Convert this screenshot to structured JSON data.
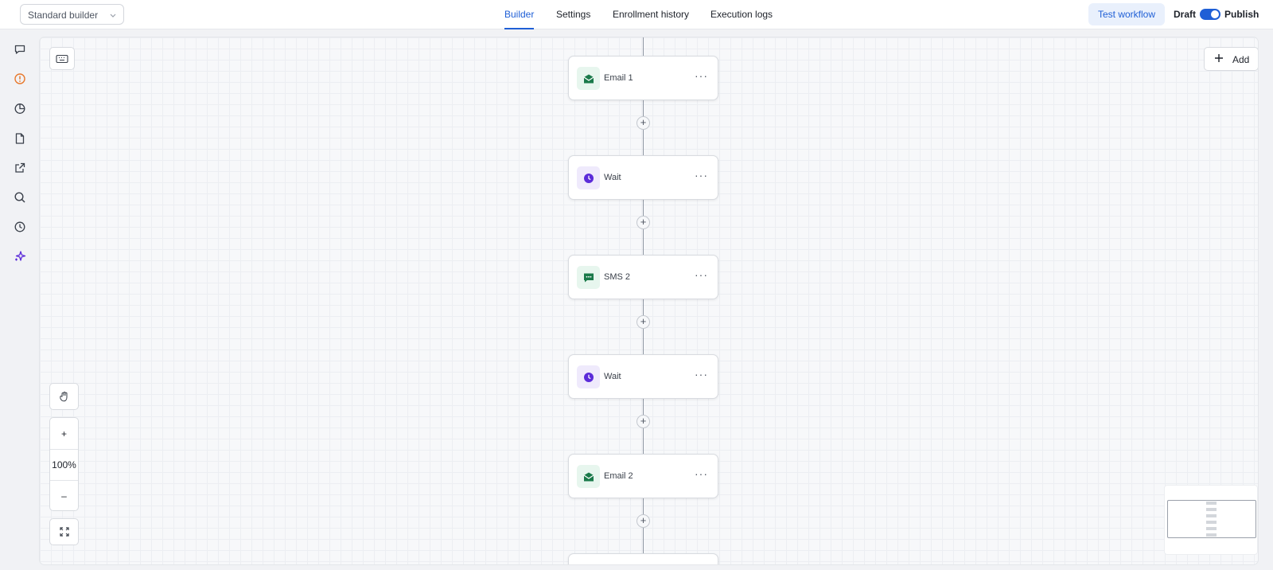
{
  "header": {
    "builder_select": "Standard builder",
    "tabs": [
      {
        "label": "Builder",
        "active": true
      },
      {
        "label": "Settings",
        "active": false
      },
      {
        "label": "Enrollment history",
        "active": false
      },
      {
        "label": "Execution logs",
        "active": false
      }
    ],
    "test_workflow": "Test workflow",
    "draft_label": "Draft",
    "publish_label": "Publish",
    "publish_toggle_on": true
  },
  "sidebar": {
    "icons": [
      "chat-icon",
      "alert-circle-icon",
      "pie-chart-icon",
      "document-icon",
      "external-link-icon",
      "search-icon",
      "history-icon",
      "sparkles-icon"
    ]
  },
  "canvas": {
    "add_label": "Add",
    "zoom_level": "100%",
    "zoom_in": "+",
    "zoom_out": "–",
    "add_step_symbol": "+",
    "nodes": [
      {
        "label": "Email 1",
        "icon": "email-icon",
        "type": "email"
      },
      {
        "label": "Wait",
        "icon": "clock-icon",
        "type": "wait"
      },
      {
        "label": "SMS 2",
        "icon": "sms-icon",
        "type": "sms"
      },
      {
        "label": "Wait",
        "icon": "clock-icon",
        "type": "wait"
      },
      {
        "label": "Email 2",
        "icon": "email-icon",
        "type": "email"
      }
    ],
    "more_symbol": "···"
  },
  "colors": {
    "accent": "#1f5fd6",
    "email_green": "#1a7a4a",
    "wait_purple": "#5b2bd9",
    "alert_orange": "#e8792d"
  }
}
